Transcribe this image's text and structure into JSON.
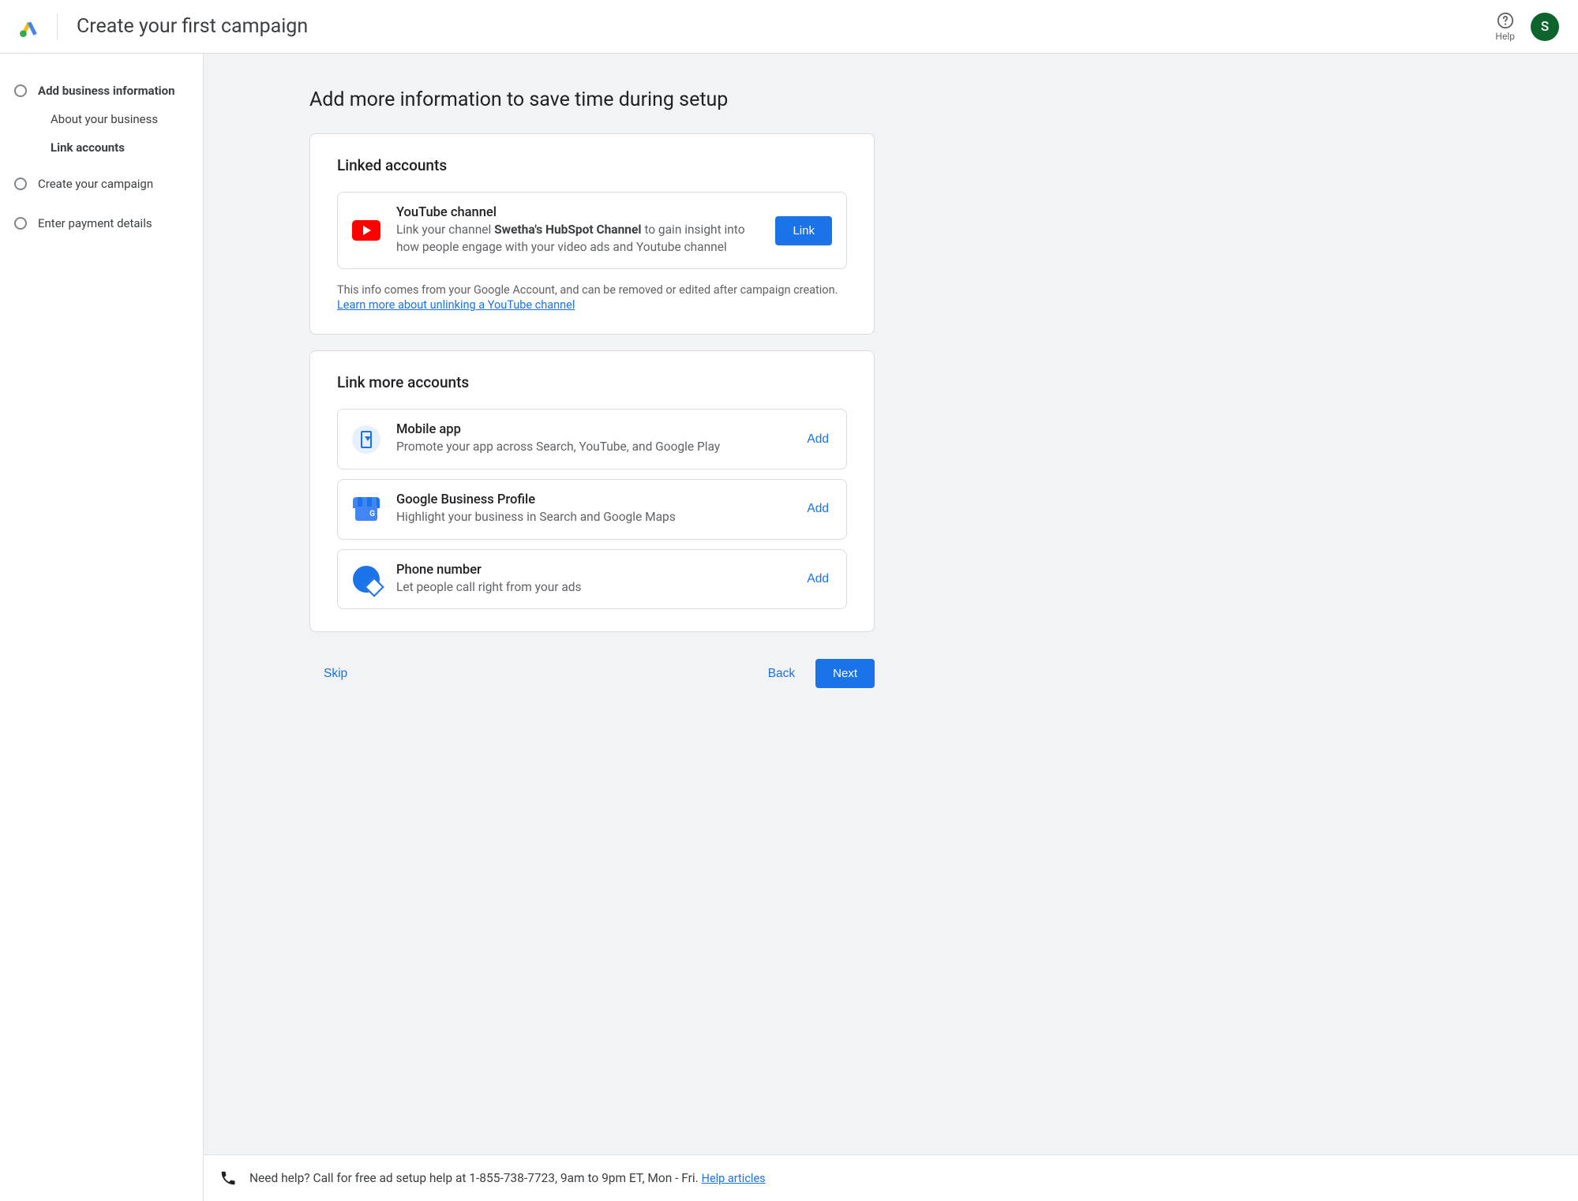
{
  "header": {
    "title": "Create your first campaign",
    "help_label": "Help",
    "avatar_initial": "S"
  },
  "sidebar": {
    "steps": [
      {
        "label": "Add business information",
        "active": true,
        "sub": [
          {
            "label": "About your business",
            "active": false
          },
          {
            "label": "Link accounts",
            "active": true
          }
        ]
      },
      {
        "label": "Create your campaign"
      },
      {
        "label": "Enter payment details"
      }
    ]
  },
  "main": {
    "heading": "Add more information to save time during setup",
    "linked_card": {
      "title": "Linked accounts",
      "youtube": {
        "title": "YouTube channel",
        "desc_prefix": "Link your channel ",
        "channel_name": "Swetha's HubSpot Channel",
        "desc_suffix": " to gain insight into how people engage with your video ads and Youtube channel",
        "button": "Link"
      },
      "info_text": "This info comes from your Google Account, and can be removed or edited after campaign creation.",
      "info_link": "Learn more about unlinking a YouTube channel"
    },
    "more_card": {
      "title": "Link more accounts",
      "items": [
        {
          "name": "Mobile app",
          "desc": "Promote your app across Search, YouTube, and Google Play",
          "button": "Add",
          "icon": "mobile-app-icon"
        },
        {
          "name": "Google Business Profile",
          "desc": "Highlight your business in Search and Google Maps",
          "button": "Add",
          "icon": "gbp-icon"
        },
        {
          "name": "Phone number",
          "desc": "Let people call right from your ads",
          "button": "Add",
          "icon": "phone-number-icon"
        }
      ]
    }
  },
  "footer": {
    "skip": "Skip",
    "back": "Back",
    "next": "Next"
  },
  "helpbar": {
    "text": "Need help? Call for free ad setup help at 1-855-738-7723, 9am to 9pm ET, Mon - Fri. ",
    "link": "Help articles"
  }
}
